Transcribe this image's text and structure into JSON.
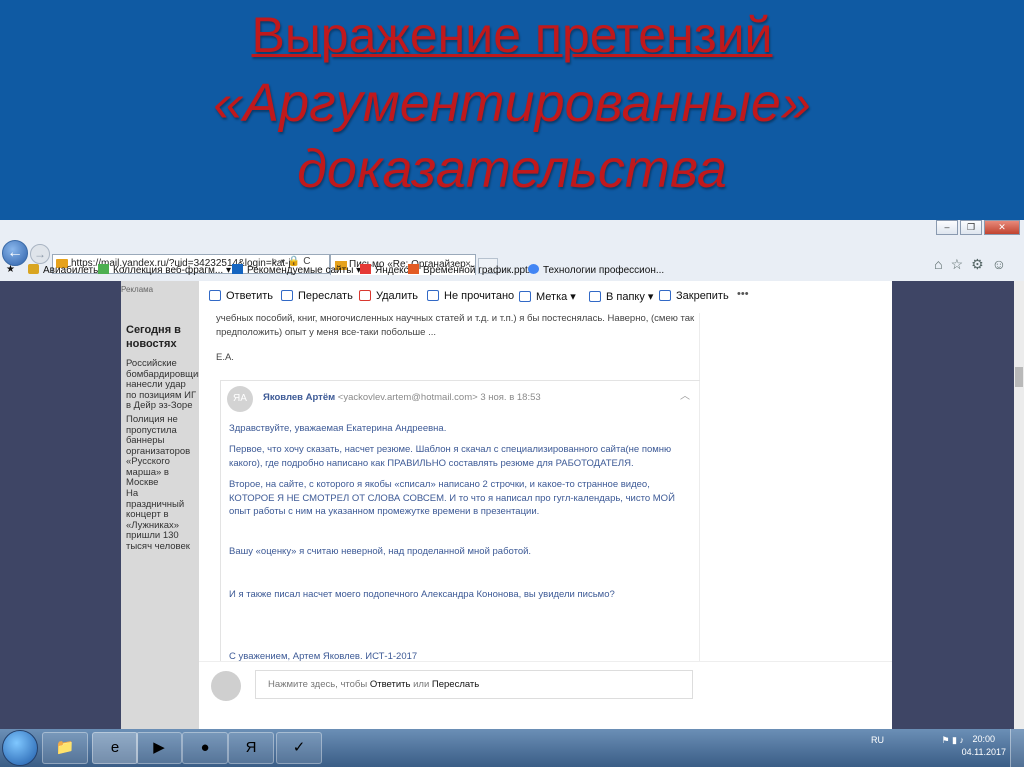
{
  "slide": {
    "title_line1": "Выражение претензий",
    "title_line2": "«Аргументированные»",
    "title_line3": "доказательства",
    "title_color": "#c0191c",
    "background_color": "#0f5aa3"
  },
  "browser": {
    "window_controls": [
      "minimize",
      "restore",
      "close"
    ],
    "url": "https://mail.yandex.ru/?uid=34232514&login=kat-j",
    "tab_title": "Письмо «Re: Органайзер ...",
    "favorites": [
      {
        "label": "Авиабилеты",
        "icon": "plane-icon"
      },
      {
        "label": "Коллекция веб-фрагм... ▾",
        "icon": "webslice-icon"
      },
      {
        "label": "Рекомендуемые сайты ▾",
        "icon": "bing-icon"
      },
      {
        "label": "Яндекс",
        "icon": "yandex-icon"
      },
      {
        "label": "Временной график.pptx",
        "icon": "ppt-icon"
      },
      {
        "label": "Технологии профессион...",
        "icon": "google-icon"
      }
    ]
  },
  "sidebar": {
    "ad_label": "Реклама",
    "news_heading": "Сегодня в новостях",
    "news": [
      "Российские бомбардировщики нанесли удар по позициям ИГ в Дейр эз-Зоре",
      "Полиция не пропустила баннеры организаторов «Русского марша» в Москве",
      "На праздничный концерт в «Лужниках» пришли 130 тысяч человек"
    ]
  },
  "toolbar": {
    "reply": "Ответить",
    "forward": "Переслать",
    "delete": "Удалить",
    "unread": "Не прочитано",
    "label": "Метка",
    "folder": "В папку",
    "pin": "Закрепить",
    "more": "•••"
  },
  "message": {
    "prev_text": "учебных пособий, книг, многочисленных научных статей и т.д. и т.п.) я бы постеснялась. Наверно, (смею так предположить) опыт у меня все-таки побольше ...",
    "prev_signature": "Е.А.",
    "avatar_initials": "ЯА",
    "sender_name": "Яковлев Артём",
    "sender_email": "<yackovlev.artem@hotmail.com>",
    "date": "3 ноя. в 18:53",
    "paragraphs": [
      "Здравствуйте, уважаемая Екатерина Андреевна.",
      "Первое, что хочу сказать, насчет резюме. Шаблон я скачал с специализированного сайта(не помню какого), где подробно написано как ПРАВИЛЬНО составлять резюме для РАБОТОДАТЕЛЯ.",
      "Второе, на сайте, с которого я якобы «списал» написано 2 строчки, и какое-то странное видео, КОТОРОЕ Я НЕ СМОТРЕЛ ОТ СЛОВА СОВСЕМ. И то что я написал про гугл-календарь, чисто МОЙ опыт работы с ним на указанном промежутке времени в презентации.",
      "Вашу «оценку» я считаю неверной, над проделанной мной работой.",
      "И я также писал насчет моего подопечного Александра Кононова, вы увидели письмо?",
      "С уважением, Артем Яковлев. ИСТ-1-2017"
    ]
  },
  "reply_box": {
    "prefix": "Нажмите здесь, чтобы ",
    "reply": "Ответить",
    "middle": " или ",
    "forward": "Переслать"
  },
  "taskbar": {
    "lang": "RU",
    "time": "20:00",
    "date": "04.11.2017"
  }
}
